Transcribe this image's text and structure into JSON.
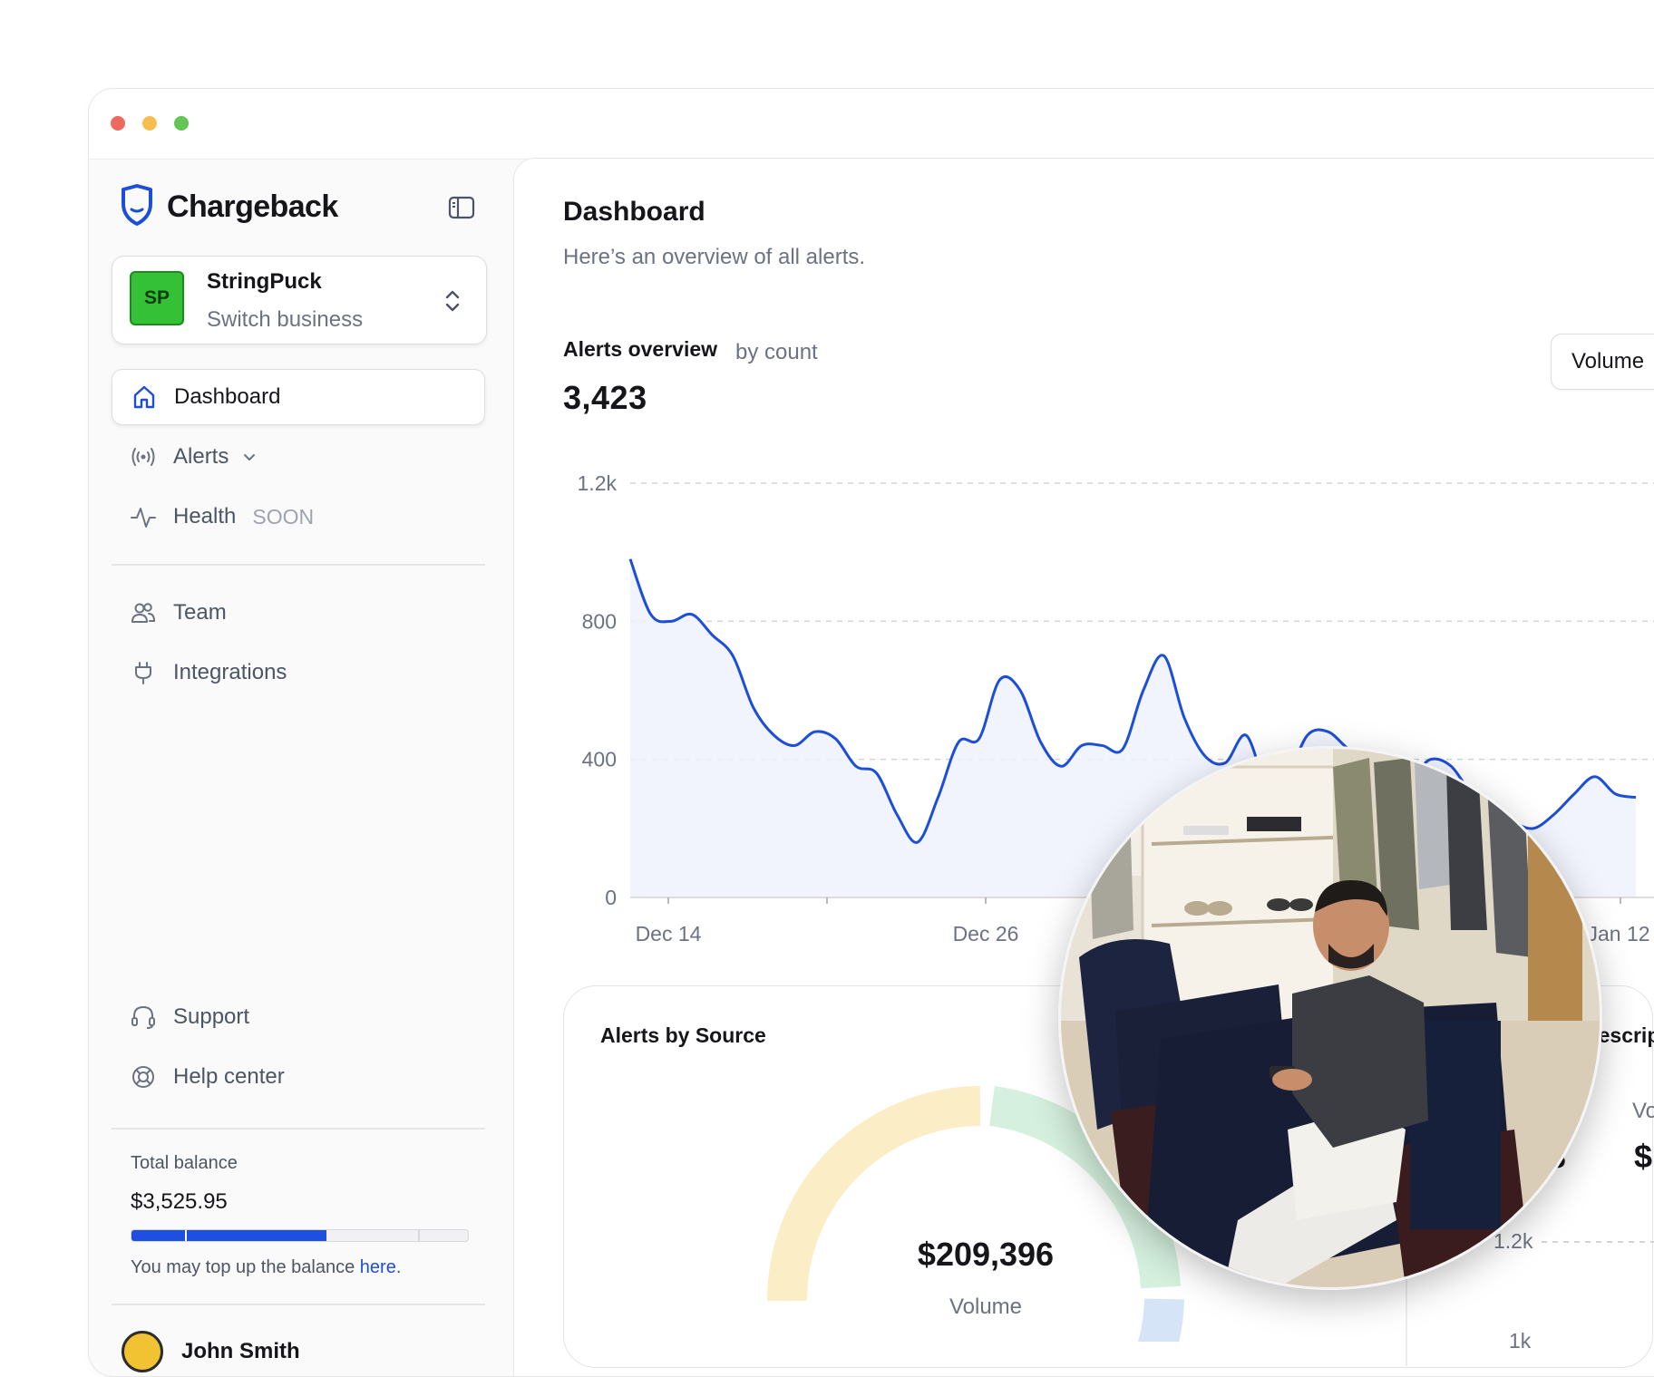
{
  "window": {
    "controls": [
      "close",
      "minimize",
      "maximize"
    ]
  },
  "sidebar": {
    "brand": {
      "name": "Chargeback",
      "icon": "shield-icon"
    },
    "toggle_icon": "sidebar-toggle-icon",
    "business": {
      "initials": "SP",
      "name": "StringPuck",
      "subtitle": "Switch business"
    },
    "nav": [
      {
        "label": "Dashboard",
        "icon": "home-icon",
        "active": true
      },
      {
        "label": "Alerts",
        "icon": "broadcast-icon",
        "expandable": true
      },
      {
        "label": "Health",
        "icon": "activity-icon",
        "badge": "SOON"
      },
      {
        "label": "Team",
        "icon": "users-icon"
      },
      {
        "label": "Integrations",
        "icon": "plug-icon"
      }
    ],
    "footer_nav": [
      {
        "label": "Support",
        "icon": "headset-icon"
      },
      {
        "label": "Help center",
        "icon": "lifebuoy-icon"
      }
    ],
    "balance": {
      "label": "Total balance",
      "value": "$3,525.95",
      "progress": 0.58,
      "note_prefix": "You may top up the balance ",
      "note_link": "here",
      "note_suffix": "."
    },
    "user": {
      "name": "John Smith"
    }
  },
  "main": {
    "title": "Dashboard",
    "subtitle": "Here’s an overview of all alerts.",
    "overview": {
      "title": "Alerts overview",
      "metric": "by count",
      "total": "3,423",
      "selector": "Volume"
    },
    "source_card": {
      "title": "Alerts by Source",
      "value": "$209,396",
      "value_label": "Volume"
    },
    "side_card": {
      "title": "Descriptors",
      "vol_label": "Vo",
      "num_fragment": "3",
      "dollar_fragment": "$",
      "tick_1": "1.2k",
      "tick_2": "1k"
    }
  },
  "chart_data": {
    "type": "area",
    "title": "Alerts overview",
    "xlabel": "",
    "ylabel": "",
    "ylim": [
      0,
      1200
    ],
    "yticks": [
      0,
      400,
      800,
      1200
    ],
    "ytick_labels": [
      "0",
      "400",
      "800",
      "1.2k"
    ],
    "xtick_labels": [
      "Dec 14",
      "Dec 26",
      "Jan 12"
    ],
    "grid": true,
    "color": "#1d4ed8",
    "x": [
      0,
      1,
      2,
      3,
      4,
      5,
      6,
      7,
      8,
      9,
      10,
      11,
      12,
      13,
      14,
      15,
      16,
      17,
      18,
      19,
      20,
      21,
      22,
      23,
      24,
      25,
      26,
      27,
      28,
      29,
      30,
      31,
      32,
      33,
      34,
      35,
      36,
      37,
      38,
      39,
      40,
      41,
      42,
      43,
      44,
      45,
      46,
      47,
      48,
      49
    ],
    "values": [
      980,
      820,
      800,
      820,
      760,
      700,
      550,
      470,
      440,
      480,
      460,
      380,
      360,
      240,
      160,
      290,
      450,
      460,
      630,
      600,
      450,
      380,
      440,
      440,
      430,
      600,
      700,
      520,
      410,
      390,
      470,
      330,
      350,
      470,
      480,
      430,
      400,
      380,
      350,
      400,
      380,
      300,
      260,
      220,
      200,
      240,
      300,
      350,
      300,
      290
    ]
  }
}
